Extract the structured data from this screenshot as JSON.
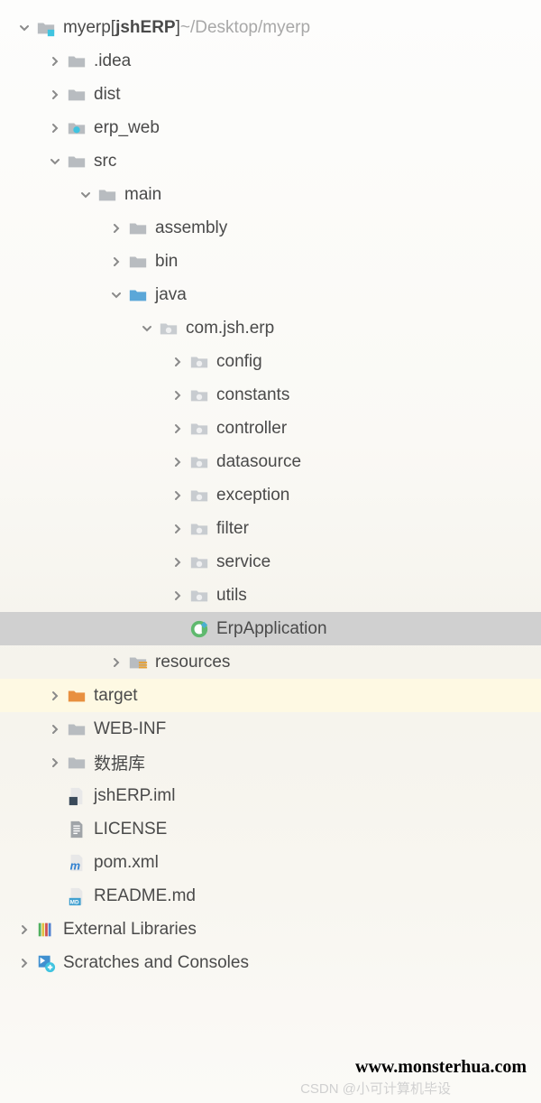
{
  "root": {
    "name": "myerp",
    "module": "jshERP",
    "path": "~/Desktop/myerp"
  },
  "tree": [
    {
      "depth": 0,
      "arrow": "down",
      "icon": "folder-module",
      "type": "root"
    },
    {
      "depth": 1,
      "arrow": "right",
      "icon": "folder",
      "label": ".idea"
    },
    {
      "depth": 1,
      "arrow": "right",
      "icon": "folder",
      "label": "dist"
    },
    {
      "depth": 1,
      "arrow": "right",
      "icon": "folder-dot",
      "label": "erp_web"
    },
    {
      "depth": 1,
      "arrow": "down",
      "icon": "folder",
      "label": "src"
    },
    {
      "depth": 2,
      "arrow": "down",
      "icon": "folder",
      "label": "main"
    },
    {
      "depth": 3,
      "arrow": "right",
      "icon": "folder",
      "label": "assembly"
    },
    {
      "depth": 3,
      "arrow": "right",
      "icon": "folder",
      "label": "bin"
    },
    {
      "depth": 3,
      "arrow": "down",
      "icon": "folder-source",
      "label": "java"
    },
    {
      "depth": 4,
      "arrow": "down",
      "icon": "package",
      "label": "com.jsh.erp"
    },
    {
      "depth": 5,
      "arrow": "right",
      "icon": "package",
      "label": "config"
    },
    {
      "depth": 5,
      "arrow": "right",
      "icon": "package",
      "label": "constants"
    },
    {
      "depth": 5,
      "arrow": "right",
      "icon": "package",
      "label": "controller"
    },
    {
      "depth": 5,
      "arrow": "right",
      "icon": "package",
      "label": "datasource"
    },
    {
      "depth": 5,
      "arrow": "right",
      "icon": "package",
      "label": "exception"
    },
    {
      "depth": 5,
      "arrow": "right",
      "icon": "package",
      "label": "filter"
    },
    {
      "depth": 5,
      "arrow": "right",
      "icon": "package",
      "label": "service"
    },
    {
      "depth": 5,
      "arrow": "right",
      "icon": "package",
      "label": "utils"
    },
    {
      "depth": 5,
      "arrow": "none",
      "icon": "java-class",
      "label": "ErpApplication",
      "selected": true
    },
    {
      "depth": 3,
      "arrow": "right",
      "icon": "folder-resources",
      "label": "resources"
    },
    {
      "depth": 1,
      "arrow": "right",
      "icon": "folder-orange",
      "label": "target",
      "orange": true
    },
    {
      "depth": 1,
      "arrow": "right",
      "icon": "folder",
      "label": "WEB-INF"
    },
    {
      "depth": 1,
      "arrow": "right",
      "icon": "folder",
      "label": "数据库"
    },
    {
      "depth": 1,
      "arrow": "none",
      "icon": "iml-file",
      "label": "jshERP.iml"
    },
    {
      "depth": 1,
      "arrow": "none",
      "icon": "text-file",
      "label": "LICENSE"
    },
    {
      "depth": 1,
      "arrow": "none",
      "icon": "maven-file",
      "label": "pom.xml"
    },
    {
      "depth": 1,
      "arrow": "none",
      "icon": "md-file",
      "label": "README.md"
    },
    {
      "depth": 0,
      "arrow": "right",
      "icon": "libraries",
      "label": "External Libraries"
    },
    {
      "depth": 0,
      "arrow": "right",
      "icon": "scratches",
      "label": "Scratches and Consoles"
    }
  ],
  "watermark1": "www.monsterhua.com",
  "watermark2": "CSDN @小可计算机毕设"
}
